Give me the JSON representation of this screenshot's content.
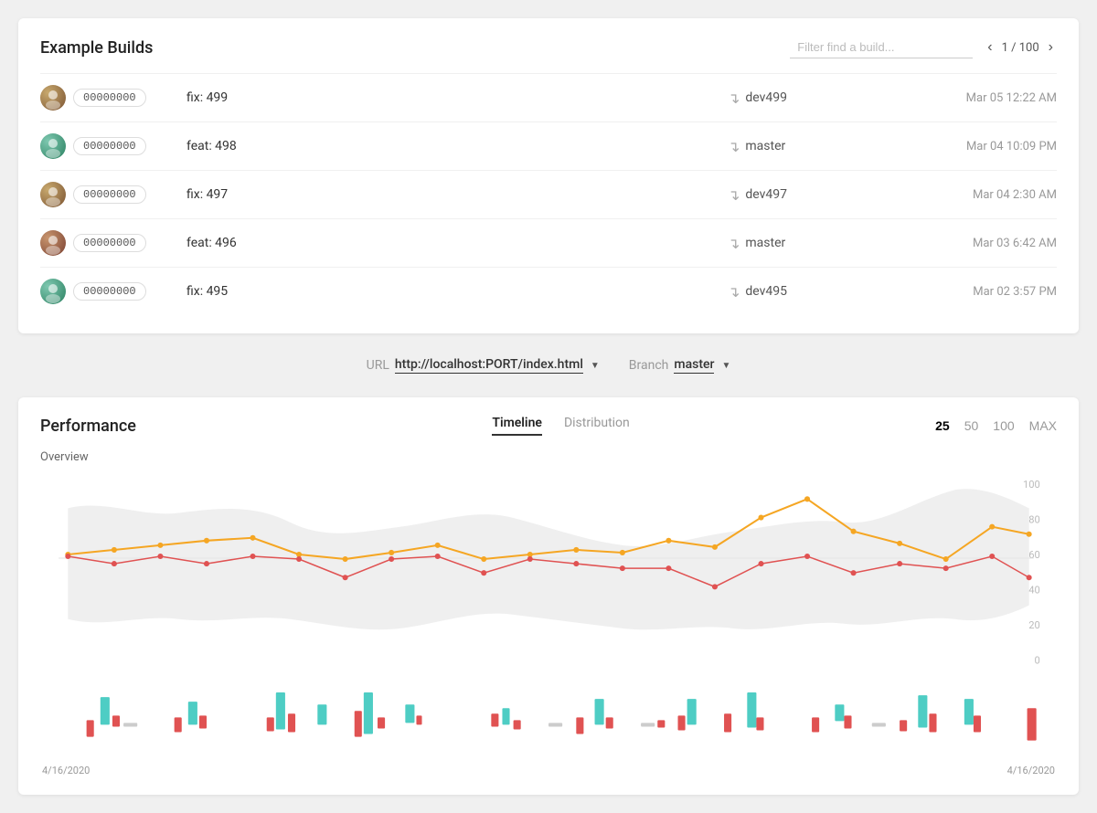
{
  "header": {
    "title": "Example Builds",
    "filter_placeholder": "Filter find a build...",
    "pagination": "1 / 100"
  },
  "builds": [
    {
      "id": "00000000",
      "desc": "fix: 499",
      "branch": "dev499",
      "date": "Mar 05 12:22 AM",
      "avatar_class": "avatar-1"
    },
    {
      "id": "00000000",
      "desc": "feat: 498",
      "branch": "master",
      "date": "Mar 04 10:09 PM",
      "avatar_class": "avatar-2"
    },
    {
      "id": "00000000",
      "desc": "fix: 497",
      "branch": "dev497",
      "date": "Mar 04 2:30 AM",
      "avatar_class": "avatar-3"
    },
    {
      "id": "00000000",
      "desc": "feat: 496",
      "branch": "master",
      "date": "Mar 03 6:42 AM",
      "avatar_class": "avatar-4"
    },
    {
      "id": "00000000",
      "desc": "fix: 495",
      "branch": "dev495",
      "date": "Mar 02 3:57 PM",
      "avatar_class": "avatar-5"
    }
  ],
  "selectors": {
    "url_label": "URL",
    "url_value": "http://localhost:PORT/index.html",
    "branch_label": "Branch",
    "branch_value": "master"
  },
  "performance": {
    "title": "Performance",
    "tabs": [
      "Timeline",
      "Distribution"
    ],
    "active_tab": "Timeline",
    "limits": [
      "25",
      "50",
      "100",
      "MAX"
    ],
    "active_limit": "25",
    "overview_label": "Overview",
    "y_labels": [
      "100",
      "80",
      "60",
      "40",
      "20",
      "0"
    ],
    "date_left": "4/16/2020",
    "date_right": "4/16/2020"
  }
}
